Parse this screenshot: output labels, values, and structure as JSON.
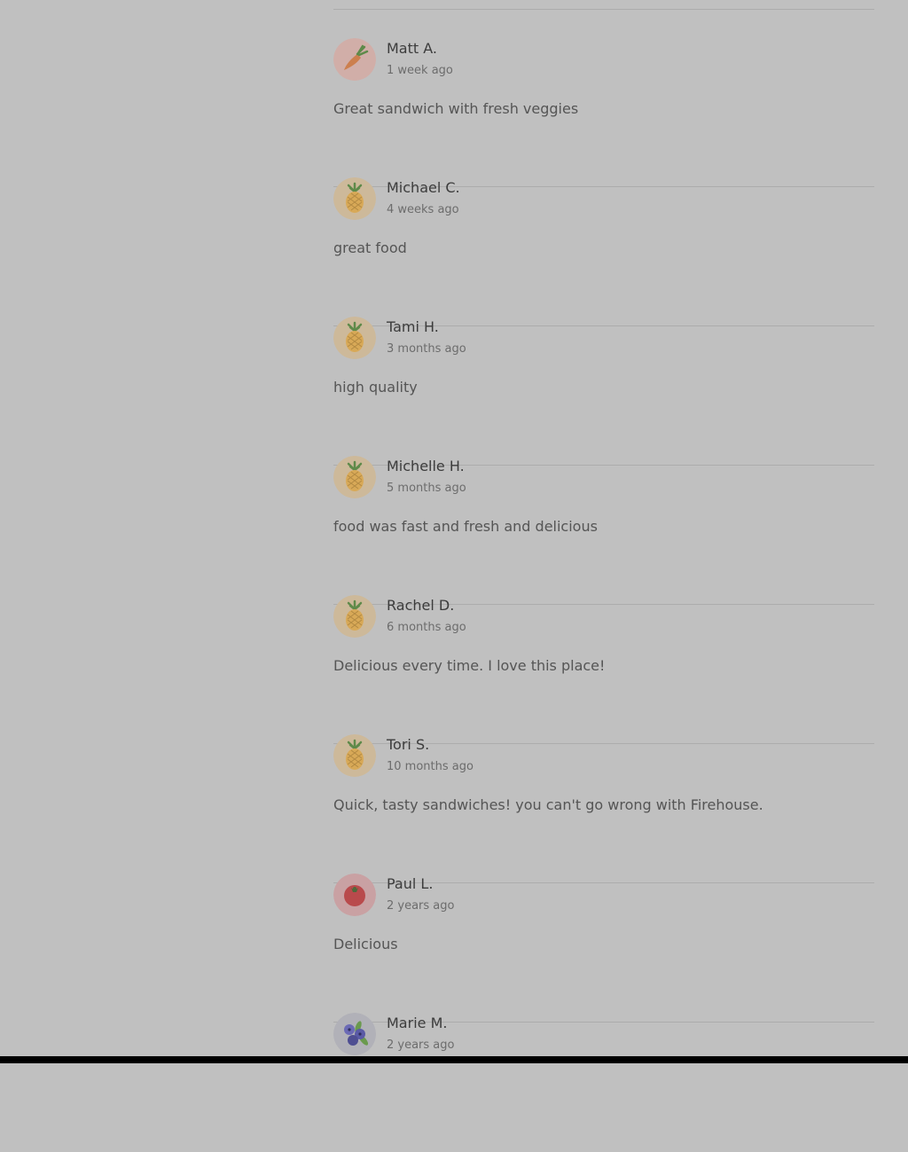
{
  "colors": {
    "page_background": "#c0c0c0",
    "divider": "#acacac",
    "name_text": "#3c3c3c",
    "time_text": "#6c6c6c",
    "review_text": "#555555"
  },
  "reviews": [
    {
      "name": "Matt A.",
      "time": "1 week ago",
      "text": "Great sandwich with fresh veggies",
      "avatar": "carrot-icon"
    },
    {
      "name": "Michael C.",
      "time": "4 weeks ago",
      "text": "great food",
      "avatar": "pineapple-icon"
    },
    {
      "name": "Tami H.",
      "time": "3 months ago",
      "text": "high quality",
      "avatar": "pineapple-icon"
    },
    {
      "name": "Michelle H.",
      "time": "5 months ago",
      "text": "food was fast and fresh and delicious",
      "avatar": "pineapple-icon"
    },
    {
      "name": "Rachel D.",
      "time": "6 months ago",
      "text": "Delicious every time. I love this place!",
      "avatar": "pineapple-icon"
    },
    {
      "name": "Tori S.",
      "time": "10 months ago",
      "text": "Quick, tasty sandwiches! you can't go wrong with Firehouse.",
      "avatar": "pineapple-icon"
    },
    {
      "name": "Paul L.",
      "time": "2 years ago",
      "text": "Delicious",
      "avatar": "tomato-icon"
    },
    {
      "name": "Marie M.",
      "time": "2 years ago",
      "text": "",
      "avatar": "blueberry-icon"
    }
  ]
}
